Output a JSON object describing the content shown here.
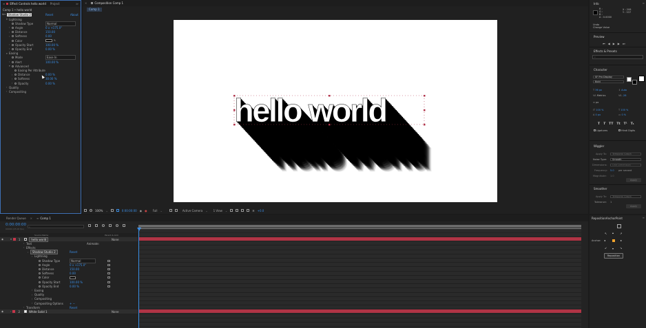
{
  "effect_controls": {
    "tabs": [
      "Effect Controls hello world",
      "Project"
    ],
    "subtitle": "Comp 1 • hello world",
    "effect_name": "Shadow Studio 2",
    "reset": "Reset",
    "about": "About",
    "rows": [
      {
        "label": "Lightning",
        "indent": 1,
        "twirl": "▾"
      },
      {
        "label": "Shadow Type",
        "indent": 2,
        "value": "Normal",
        "dropdown": true
      },
      {
        "label": "Angle",
        "indent": 2,
        "twirl": "›",
        "value": "0 x +175.0°"
      },
      {
        "label": "Distance",
        "indent": 2,
        "twirl": "›",
        "value": "150.00"
      },
      {
        "label": "Softness",
        "indent": 2,
        "twirl": "›",
        "value": "0.00"
      },
      {
        "label": "Color",
        "indent": 2,
        "swatch": true
      },
      {
        "label": "Opacity Start",
        "indent": 2,
        "twirl": "›",
        "value": "100.00 %"
      },
      {
        "label": "Opacity End",
        "indent": 2,
        "twirl": "›",
        "value": "0.00 %"
      },
      {
        "label": "Easing",
        "indent": 1,
        "twirl": "▾"
      },
      {
        "label": "Mode",
        "indent": 2,
        "value": "Ease In",
        "dropdown": true
      },
      {
        "label": "Alert",
        "indent": 2,
        "twirl": "›",
        "value": "100.00 %"
      },
      {
        "label": "Advanced",
        "indent": 2,
        "twirl": "▾"
      },
      {
        "label": "Easing Per Attribute",
        "indent": 3
      },
      {
        "label": "Distance",
        "indent": 3,
        "twirl": "›",
        "value": "0.00 %"
      },
      {
        "label": "Softness",
        "indent": 3,
        "twirl": "›",
        "value": "30.00 %"
      },
      {
        "label": "Opacity",
        "indent": 3,
        "twirl": "›",
        "value": "0.00 %"
      },
      {
        "label": "Quality",
        "indent": 1,
        "twirl": "›"
      },
      {
        "label": "Compositing",
        "indent": 1,
        "twirl": "›"
      }
    ]
  },
  "composition": {
    "tab": "Composition Comp 1",
    "comp_tag": "Comp 1",
    "text": "hello world",
    "bottom_bar": {
      "zoom": "100%",
      "timecode": "0:00:00:00",
      "resolution": "Full",
      "camera": "Active Camera",
      "view": "1 View",
      "exposure": "+0.0"
    }
  },
  "right_panel": {
    "info": {
      "title": "Info",
      "r": "R :",
      "g": "G :",
      "b": "B :",
      "a": "A : 0.0000",
      "x": "X : 208",
      "y": "Y : 537",
      "undo": "Undo",
      "action": "Change Value"
    },
    "preview": {
      "title": "Preview"
    },
    "effects_presets": {
      "title": "Effects & Presets",
      "search_placeholder": "⌕"
    },
    "character": {
      "title": "Character",
      "font": "SF Pro Display",
      "style": "Bold",
      "size": "36 px",
      "leading": "Auto",
      "kerning": "Metrics",
      "tracking": "-28",
      "stroke": "px",
      "vscale": "100 %",
      "hscale": "100 %",
      "baseline": "0 px",
      "tsume": "0 %",
      "ligatures": "Ligatures",
      "hindi": "Hindi Digits"
    },
    "wiggler": {
      "title": "Wiggler",
      "apply_to": "Apply To:",
      "apply_value": "Temporal Graph",
      "noise_type": "Noise Type:",
      "noise_value": "Smooth",
      "dimensions": "Dimensions:",
      "dimensions_value": "One Dimension",
      "frequency": "Frequency:",
      "frequency_value": "5.0",
      "frequency_unit": "per second",
      "magnitude": "Magnitude:",
      "magnitude_value": "1.0",
      "apply": "Apply"
    },
    "smoother": {
      "title": "Smoother",
      "apply_to": "Apply To:",
      "apply_value": "Temporal Graph",
      "tolerance": "Tolerance:",
      "tolerance_value": "1",
      "apply": "Apply"
    },
    "reposition": {
      "title": "RepositionAnchorPoint",
      "anchor": "Anchor:",
      "button": "Reposition"
    }
  },
  "timeline": {
    "tabs": [
      "Render Queue",
      "Comp 1"
    ],
    "timecode": "0:00:00:00",
    "fps": "00000 (25.00 fps)",
    "columns": {
      "source": "Source Name",
      "parent": "Parent & Link"
    },
    "layers": [
      {
        "num": "1",
        "name": "hello world",
        "parent": "None",
        "color": "#c8364a"
      },
      {
        "num": "2",
        "name": "White Solid 1",
        "parent": "None",
        "color": "#c8364a"
      }
    ],
    "props": [
      {
        "label": "Text",
        "indent": 1,
        "extra": "Animate:"
      },
      {
        "label": "Effects",
        "indent": 1
      },
      {
        "label": "Shadow Studio 2",
        "indent": 2,
        "value": "Reset"
      },
      {
        "label": "Lightning",
        "indent": 3
      },
      {
        "label": "Shadow Type",
        "indent": 4,
        "value": "Normal"
      },
      {
        "label": "Angle",
        "indent": 4,
        "value": "0 x +175.0°"
      },
      {
        "label": "Distance",
        "indent": 4,
        "value": "150.00"
      },
      {
        "label": "Softness",
        "indent": 4,
        "value": "0.00"
      },
      {
        "label": "Color",
        "indent": 4,
        "swatch": true
      },
      {
        "label": "Opacity Start",
        "indent": 4,
        "value": "100.00 %"
      },
      {
        "label": "Opacity End",
        "indent": 4,
        "value": "0.00 %"
      },
      {
        "label": "Easing",
        "indent": 3
      },
      {
        "label": "Quality",
        "indent": 3
      },
      {
        "label": "Compositing",
        "indent": 3
      },
      {
        "label": "Compositing Options",
        "indent": 3,
        "value": "+ −"
      },
      {
        "label": "Transform",
        "indent": 1,
        "value": "Reset"
      }
    ]
  }
}
